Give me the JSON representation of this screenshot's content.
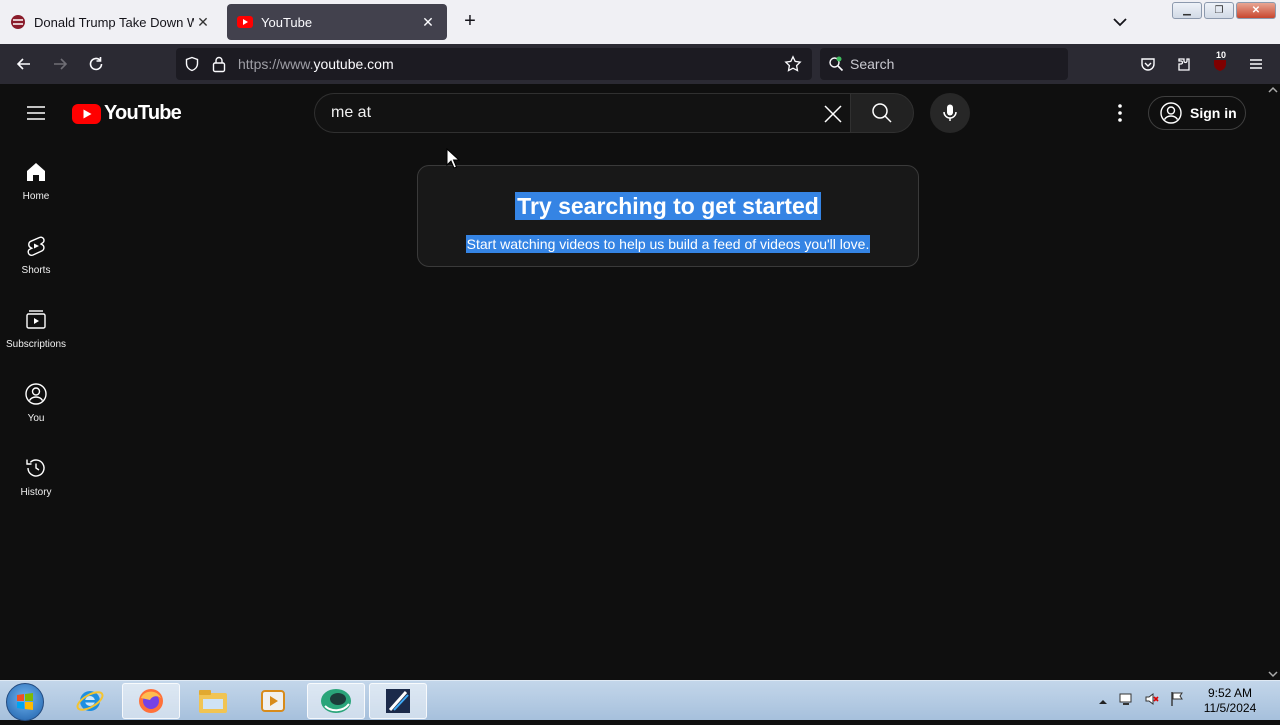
{
  "browser": {
    "tabs": [
      {
        "title": "Donald Trump Take Down WWE",
        "active": false
      },
      {
        "title": "YouTube",
        "active": true
      }
    ],
    "url_prefix": "https://www.",
    "url_domain": "youtube.com",
    "search_placeholder": "Search",
    "extension_badge": "10"
  },
  "youtube": {
    "logo_text": "YouTube",
    "search_value": "me at",
    "signin_label": "Sign in",
    "sidebar": [
      {
        "label": "Home",
        "icon": "home-icon"
      },
      {
        "label": "Shorts",
        "icon": "shorts-icon"
      },
      {
        "label": "Subscriptions",
        "icon": "subscriptions-icon"
      },
      {
        "label": "You",
        "icon": "you-icon"
      },
      {
        "label": "History",
        "icon": "history-icon"
      }
    ],
    "empty_state": {
      "title": "Try searching to get started",
      "subtitle": "Start watching videos to help us build a feed of videos you'll love."
    },
    "colors": {
      "brand_red": "#ff0000",
      "selection": "#3584e4",
      "background": "#0f0f0f"
    }
  },
  "taskbar": {
    "time": "9:52 AM",
    "date": "11/5/2024",
    "apps": [
      "internet-explorer-icon",
      "firefox-icon",
      "file-explorer-icon",
      "media-player-icon",
      "app-icon",
      "video-editor-icon"
    ]
  }
}
